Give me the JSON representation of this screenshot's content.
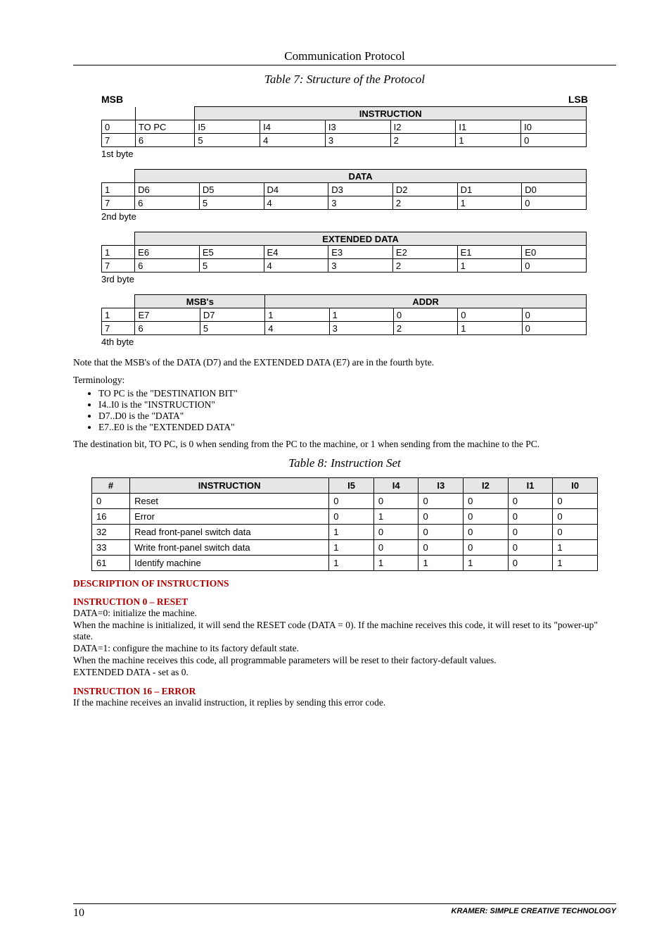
{
  "header": {
    "title": "Communication Protocol"
  },
  "caption7": "Table 7: Structure of the Protocol",
  "msb": "MSB",
  "lsb": "LSB",
  "byte1": {
    "title": "INSTRUCTION",
    "r0": [
      "0",
      "TO PC",
      "I5",
      "I4",
      "I3",
      "I2",
      "I1",
      "I0"
    ],
    "r1": [
      "7",
      "6",
      "5",
      "4",
      "3",
      "2",
      "1",
      "0"
    ],
    "label": "1st byte"
  },
  "byte2": {
    "title": "DATA",
    "r0": [
      "1",
      "D6",
      "D5",
      "D4",
      "D3",
      "D2",
      "D1",
      "D0"
    ],
    "r1": [
      "7",
      "6",
      "5",
      "4",
      "3",
      "2",
      "1",
      "0"
    ],
    "label": "2nd byte"
  },
  "byte3": {
    "title": "EXTENDED DATA",
    "r0": [
      "1",
      "E6",
      "E5",
      "E4",
      "E3",
      "E2",
      "E1",
      "E0"
    ],
    "r1": [
      "7",
      "6",
      "5",
      "4",
      "3",
      "2",
      "1",
      "0"
    ],
    "label": "3rd byte"
  },
  "byte4": {
    "t1": "MSB's",
    "t2": "ADDR",
    "r0": [
      "1",
      "E7",
      "D7",
      "1",
      "1",
      "0",
      "0",
      "0"
    ],
    "r1": [
      "7",
      "6",
      "5",
      "4",
      "3",
      "2",
      "1",
      "0"
    ],
    "label": "4th byte"
  },
  "note_msb": "Note that the MSB's of the DATA (D7) and the EXTENDED DATA (E7) are in the fourth byte.",
  "terminology_h": "Terminology:",
  "terms": [
    "TO PC is the \"DESTINATION BIT\"",
    "I4..I0 is the \"INSTRUCTION\"",
    "D7..D0 is the \"DATA\"",
    "E7..E0 is the \"EXTENDED DATA\""
  ],
  "dest_note": "The destination bit, TO PC, is 0 when sending from the PC to the machine, or 1 when sending from the machine to the PC.",
  "caption8": "Table 8: Instruction Set",
  "instr_head": [
    "#",
    "INSTRUCTION",
    "I5",
    "I4",
    "I3",
    "I2",
    "I1",
    "I0"
  ],
  "instr_rows": [
    [
      "0",
      "Reset",
      "0",
      "0",
      "0",
      "0",
      "0",
      "0"
    ],
    [
      "16",
      "Error",
      "0",
      "1",
      "0",
      "0",
      "0",
      "0"
    ],
    [
      "32",
      "Read front-panel switch data",
      "1",
      "0",
      "0",
      "0",
      "0",
      "0"
    ],
    [
      "33",
      "Write front-panel switch data",
      "1",
      "0",
      "0",
      "0",
      "0",
      "1"
    ],
    [
      "61",
      "Identify machine",
      "1",
      "1",
      "1",
      "1",
      "0",
      "1"
    ]
  ],
  "desc_h": "DESCRIPTION OF INSTRUCTIONS",
  "inst0_h": "INSTRUCTION 0 – RESET",
  "inst0_l1": "DATA=0: initialize the machine.",
  "inst0_l2": "When the machine is initialized, it will send the RESET code (DATA = 0). If the machine receives this code, it will reset to its \"power-up\" state.",
  "inst0_l3": "DATA=1: configure the machine to its factory default state.",
  "inst0_l4": "When the machine receives this code, all programmable parameters will be reset to their factory-default values.",
  "inst0_l5": "EXTENDED DATA - set as 0.",
  "inst16_h": "INSTRUCTION 16 – ERROR",
  "inst16_l1": "If the machine receives an invalid instruction, it replies by sending this error code.",
  "footer": {
    "page": "10",
    "tag": "KRAMER:  SIMPLE CREATIVE TECHNOLOGY"
  },
  "chart_data": {
    "type": "table",
    "title": "Table 8: Instruction Set",
    "columns": [
      "#",
      "INSTRUCTION",
      "I5",
      "I4",
      "I3",
      "I2",
      "I1",
      "I0"
    ],
    "rows": [
      {
        "#": 0,
        "INSTRUCTION": "Reset",
        "I5": 0,
        "I4": 0,
        "I3": 0,
        "I2": 0,
        "I1": 0,
        "I0": 0
      },
      {
        "#": 16,
        "INSTRUCTION": "Error",
        "I5": 0,
        "I4": 1,
        "I3": 0,
        "I2": 0,
        "I1": 0,
        "I0": 0
      },
      {
        "#": 32,
        "INSTRUCTION": "Read front-panel switch data",
        "I5": 1,
        "I4": 0,
        "I3": 0,
        "I2": 0,
        "I1": 0,
        "I0": 0
      },
      {
        "#": 33,
        "INSTRUCTION": "Write front-panel switch data",
        "I5": 1,
        "I4": 0,
        "I3": 0,
        "I2": 0,
        "I1": 0,
        "I0": 1
      },
      {
        "#": 61,
        "INSTRUCTION": "Identify machine",
        "I5": 1,
        "I4": 1,
        "I3": 1,
        "I2": 1,
        "I1": 0,
        "I0": 1
      }
    ]
  }
}
